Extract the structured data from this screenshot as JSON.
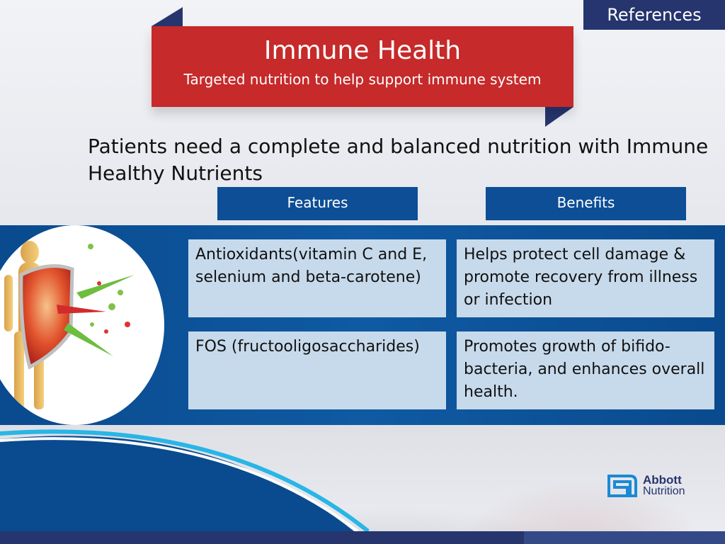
{
  "references_label": "References",
  "banner": {
    "title": "Immune Health",
    "subtitle": "Targeted nutrition to help support immune system"
  },
  "headline": "Patients need a complete and balanced nutrition with Immune Healthy Nutrients",
  "table": {
    "headers": [
      "Features",
      "Benefits"
    ],
    "rows": [
      {
        "feature": "Antioxidants(vitamin C and E, selenium and beta-carotene)",
        "benefit": "Helps protect cell damage & promote recovery from illness or infection"
      },
      {
        "feature": "FOS (fructooligosaccharides)",
        "benefit": "Promotes growth of bifido-bacteria, and enhances overall health."
      }
    ]
  },
  "logo": {
    "brand": "Abbott",
    "sub": "Nutrition"
  },
  "colors": {
    "banner": "#c62a2a",
    "navy": "#26356e",
    "blue": "#0d4e96"
  }
}
